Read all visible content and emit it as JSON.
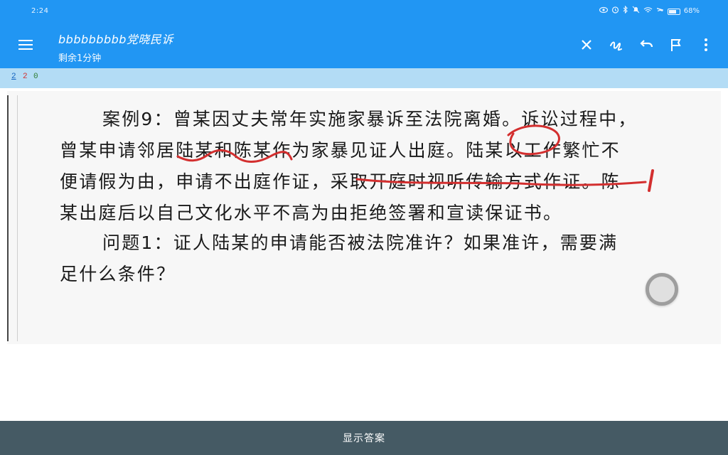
{
  "status_bar": {
    "time": "2:24",
    "battery_percent": "68%",
    "icons": [
      "eye-icon",
      "alarm-icon",
      "bluetooth-icon",
      "mute-icon",
      "wifi-icon",
      "airplane-icon",
      "battery-icon"
    ]
  },
  "app_bar": {
    "title": "bbbbbbbbb党晓民诉",
    "subtitle": "剩余1分钟",
    "actions": [
      "close-icon",
      "handwriting-icon",
      "undo-icon",
      "flag-icon",
      "more-vert-icon"
    ]
  },
  "progress": {
    "blue_number": "2",
    "red_number": "2",
    "green_number": "0"
  },
  "question": {
    "lines": [
      "案例9：曾某因丈夫常年实施家暴诉至法院离婚。诉讼过程中，",
      "曾某申请邻居陆某和陈某作为家暴见证人出庭。陆某以工作繁忙不",
      "便请假为由，申请不出庭作证，采取开庭时视听传输方式作证。陈",
      "某出庭后以自己文化水平不高为由拒绝签署和宣读保证书。",
      "问题1：证人陆某的申请能否被法院准许？如果准许，需要满",
      "足什么条件？"
    ]
  },
  "bottom_bar": {
    "label": "显示答案"
  },
  "colors": {
    "primary": "#2196f3",
    "strip": "#b3dcf5",
    "bottom": "#455a64",
    "ink": "#d32f2f"
  }
}
